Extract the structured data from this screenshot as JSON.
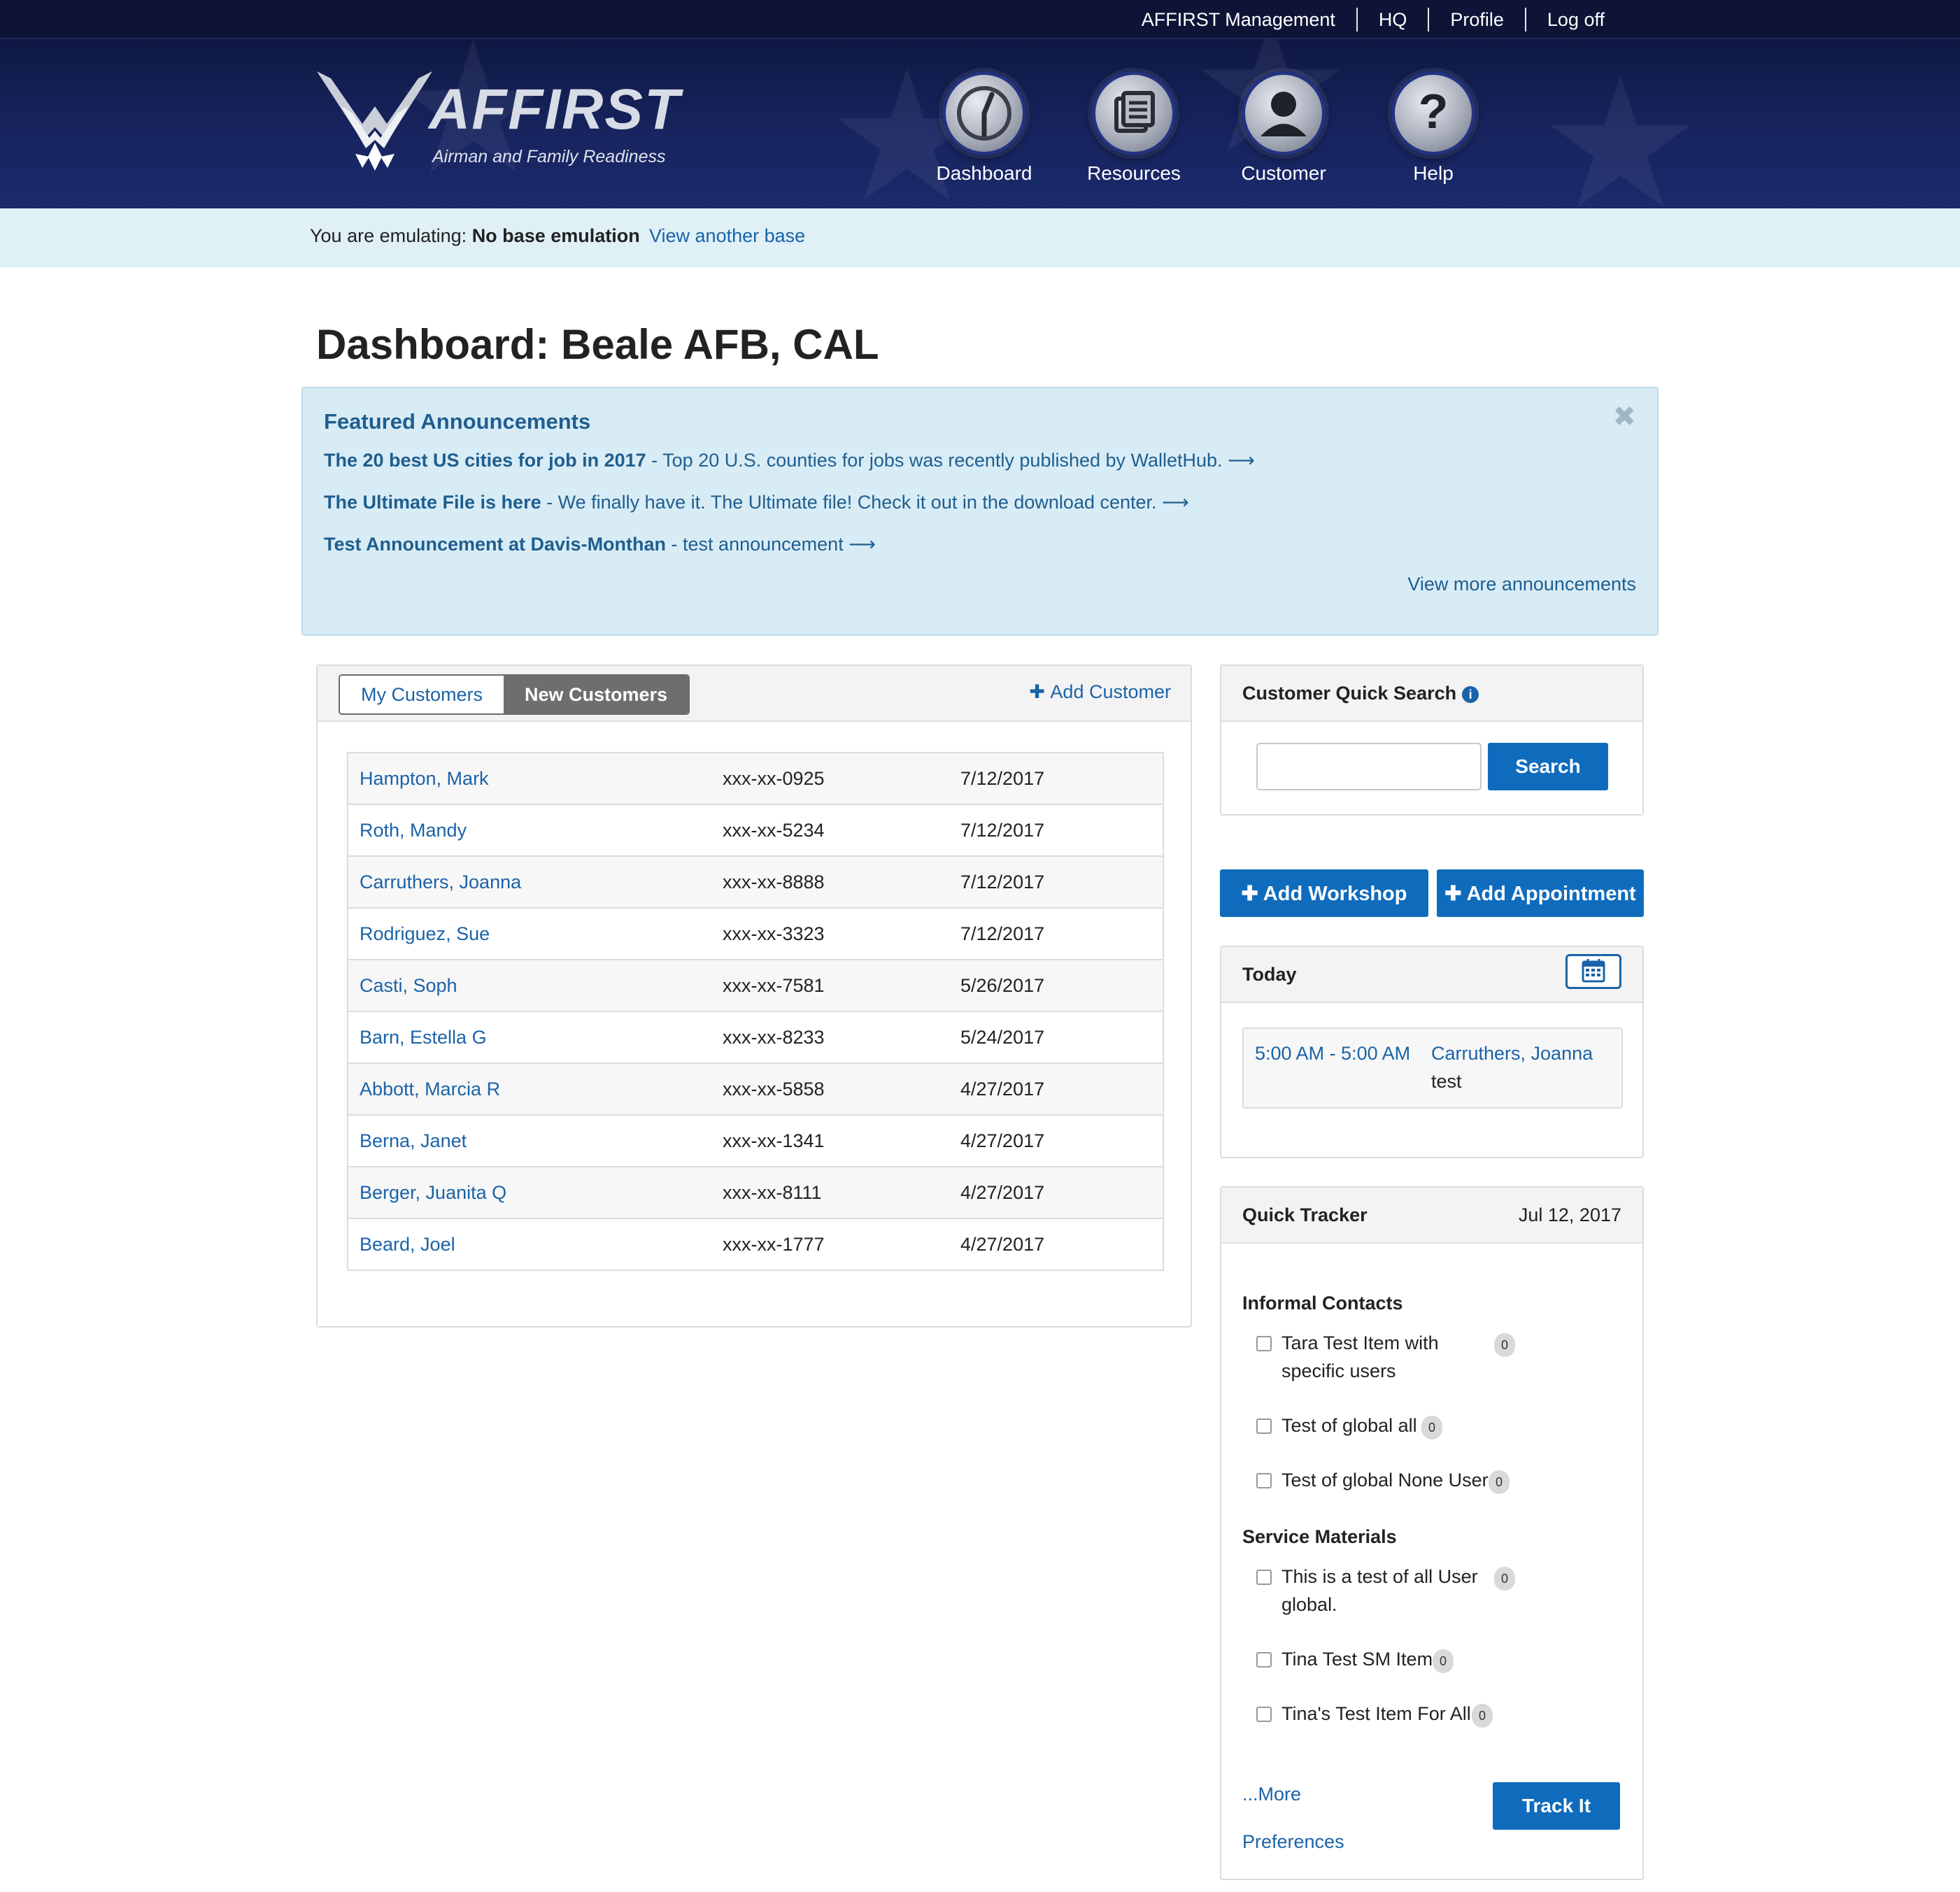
{
  "topnav": {
    "items": [
      "AFFIRST Management",
      "HQ",
      "Profile",
      "Log off"
    ]
  },
  "brand": {
    "name": "AFFIRST",
    "tagline": "Airman and Family Readiness"
  },
  "mainnav": [
    {
      "label": "Dashboard",
      "icon": "gauge-icon"
    },
    {
      "label": "Resources",
      "icon": "documents-icon"
    },
    {
      "label": "Customer",
      "icon": "person-icon"
    },
    {
      "label": "Help",
      "icon": "question-icon"
    }
  ],
  "emulation": {
    "prefix": "You are emulating:",
    "value": "No base emulation",
    "link": "View another base"
  },
  "page": {
    "title": "Dashboard: Beale AFB, CAL"
  },
  "announcements": {
    "title": "Featured Announcements",
    "items": [
      {
        "title": "The 20 best US cities for job in 2017",
        "text": " - Top 20 U.S. counties for jobs was recently published by WalletHub. ⟶"
      },
      {
        "title": "The Ultimate File is here",
        "text": " - We finally have it. The Ultimate file! Check it out in the download center. ⟶"
      },
      {
        "title": "Test Announcement at Davis-Monthan",
        "text": " - test announcement ⟶"
      }
    ],
    "more": "View more announcements"
  },
  "customers": {
    "tabs": [
      "My Customers",
      "New Customers"
    ],
    "active_tab": "New Customers",
    "add_label": "Add Customer",
    "rows": [
      {
        "name": "Hampton, Mark",
        "ssn": "xxx-xx-0925",
        "date": "7/12/2017"
      },
      {
        "name": "Roth, Mandy",
        "ssn": "xxx-xx-5234",
        "date": "7/12/2017"
      },
      {
        "name": "Carruthers, Joanna",
        "ssn": "xxx-xx-8888",
        "date": "7/12/2017"
      },
      {
        "name": "Rodriguez, Sue",
        "ssn": "xxx-xx-3323",
        "date": "7/12/2017"
      },
      {
        "name": "Casti, Soph",
        "ssn": "xxx-xx-7581",
        "date": "5/26/2017"
      },
      {
        "name": "Barn, Estella G",
        "ssn": "xxx-xx-8233",
        "date": "5/24/2017"
      },
      {
        "name": "Abbott, Marcia R",
        "ssn": "xxx-xx-5858",
        "date": "4/27/2017"
      },
      {
        "name": "Berna, Janet",
        "ssn": "xxx-xx-1341",
        "date": "4/27/2017"
      },
      {
        "name": "Berger, Juanita Q",
        "ssn": "xxx-xx-8111",
        "date": "4/27/2017"
      },
      {
        "name": "Beard, Joel",
        "ssn": "xxx-xx-1777",
        "date": "4/27/2017"
      }
    ]
  },
  "quicksearch": {
    "title": "Customer Quick Search",
    "placeholder": "",
    "button": "Search"
  },
  "actions": {
    "add_workshop": "Add Workshop",
    "add_appointment": "Add Appointment"
  },
  "today": {
    "title": "Today",
    "appointment": {
      "time": "5:00 AM - 5:00 AM",
      "name": "Carruthers, Joanna",
      "desc": "test"
    }
  },
  "tracker": {
    "title": "Quick Tracker",
    "date": "Jul 12, 2017",
    "sections": [
      {
        "title": "Informal Contacts",
        "items": [
          {
            "label": "Tara Test Item with specific users",
            "count": "0"
          },
          {
            "label": "Test of global all",
            "count": "0"
          },
          {
            "label": "Test of global None User.",
            "count": "0"
          }
        ]
      },
      {
        "title": "Service Materials",
        "items": [
          {
            "label": "This is a test of all User global.",
            "count": "0"
          },
          {
            "label": "Tina Test SM Item",
            "count": "0"
          },
          {
            "label": "Tina's Test Item For All",
            "count": "0"
          }
        ]
      }
    ],
    "more": "...More",
    "preferences": "Preferences",
    "button": "Track It"
  }
}
